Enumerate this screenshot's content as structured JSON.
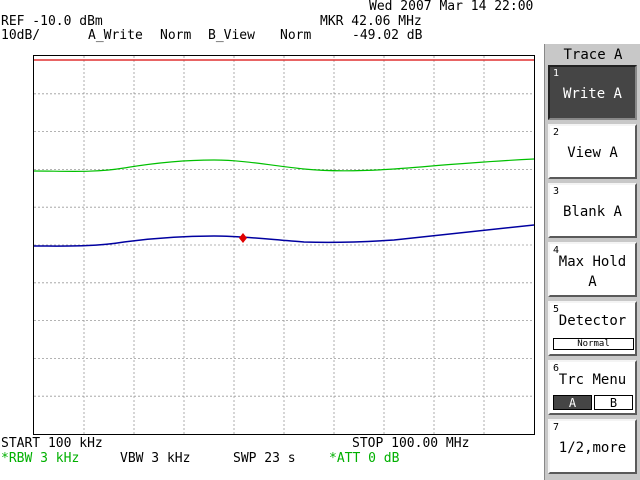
{
  "header": {
    "datetime": "Wed 2007 Mar 14 22:00",
    "ref": "REF -10.0 dBm",
    "scale": "10dB/",
    "trace_a": "A_Write",
    "detector_a": "Norm",
    "trace_b": "B_View",
    "detector_b": "Norm",
    "marker_freq": "MKR 42.06 MHz",
    "marker_level": "-49.02 dB"
  },
  "footer": {
    "start": "START 100 kHz",
    "stop": "STOP 100.00 MHz",
    "rbw": "*RBW 3 kHz",
    "vbw": "VBW 3 kHz",
    "swp": "SWP 23 s",
    "att": "*ATT 0 dB"
  },
  "panel": {
    "title": "Trace A",
    "keys": [
      {
        "num": "1",
        "label": "Write A"
      },
      {
        "num": "2",
        "label": "View A"
      },
      {
        "num": "3",
        "label": "Blank A"
      },
      {
        "num": "4",
        "label_line1": "Max Hold",
        "label_line2": "A"
      },
      {
        "num": "5",
        "label": "Detector",
        "sub": "Normal"
      },
      {
        "num": "6",
        "label": "Trc Menu",
        "opt_a": "A",
        "opt_b": "B"
      },
      {
        "num": "7",
        "label": "1/2,more"
      }
    ]
  },
  "colors": {
    "trace_a": "#00c000",
    "trace_b": "#0000a0",
    "ref_line": "#e03030",
    "marker": "#e00000",
    "grid": "#9a9a9a"
  }
}
